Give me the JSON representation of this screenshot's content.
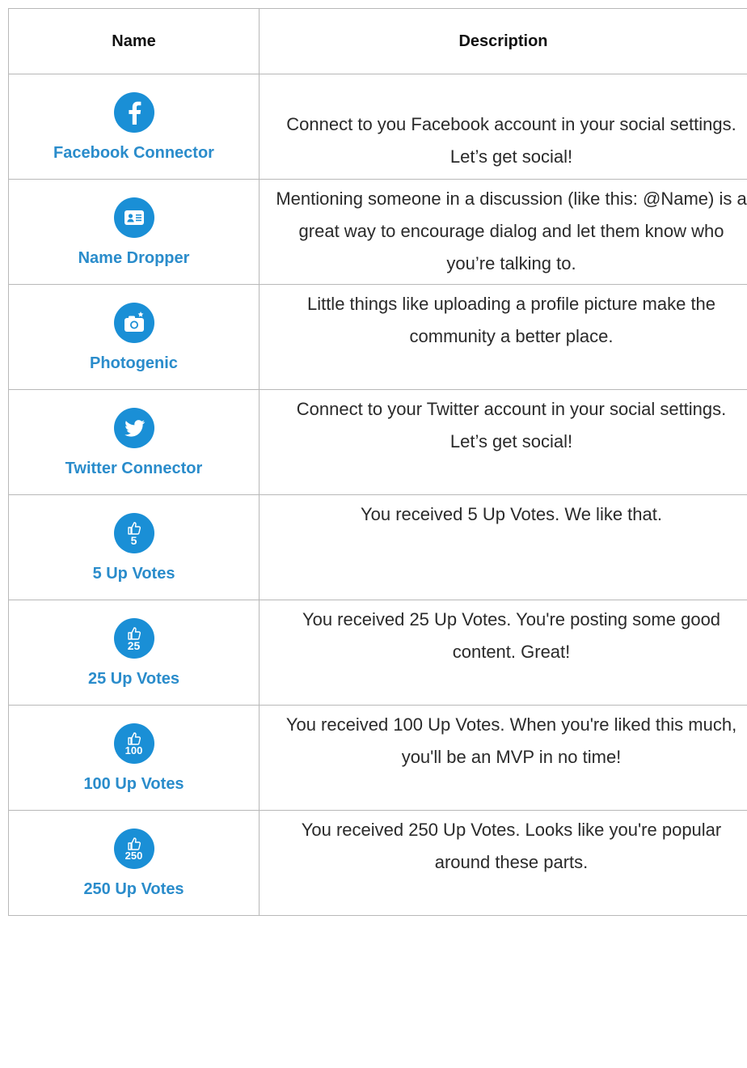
{
  "headers": {
    "name": "Name",
    "description": "Description"
  },
  "colors": {
    "accent": "#1a8fd6",
    "name_text": "#2a8ccb",
    "border": "#b8b8b8"
  },
  "rows": [
    {
      "icon": "facebook-icon",
      "name": "Facebook Connector",
      "description": "Connect to you Facebook account in your social settings. Let’s get social!"
    },
    {
      "icon": "id-card-icon",
      "name": "Name Dropper",
      "description": "Mentioning someone in a discussion (like this: @Name) is a great way to encourage dialog and let them know who you’re talking to."
    },
    {
      "icon": "camera-icon",
      "name": "Photogenic",
      "description": "Little things like uploading a profile picture make the community a better place."
    },
    {
      "icon": "twitter-icon",
      "name": "Twitter Connector",
      "description": "Connect to your Twitter account in your social settings. Let’s get social!"
    },
    {
      "icon": "thumbs-up-icon",
      "badge": "5",
      "name": "5 Up Votes",
      "description": "You received 5 Up Votes. We like that."
    },
    {
      "icon": "thumbs-up-icon",
      "badge": "25",
      "name": "25 Up Votes",
      "description": "You received 25 Up Votes. You're posting some good content. Great!"
    },
    {
      "icon": "thumbs-up-icon",
      "badge": "100",
      "name": "100 Up Votes",
      "description": "You received 100 Up Votes. When you're liked this much, you'll be an MVP in no time!"
    },
    {
      "icon": "thumbs-up-icon",
      "badge": "250",
      "name": "250 Up Votes",
      "description": "You received 250 Up Votes. Looks like you're popular around these parts."
    }
  ]
}
